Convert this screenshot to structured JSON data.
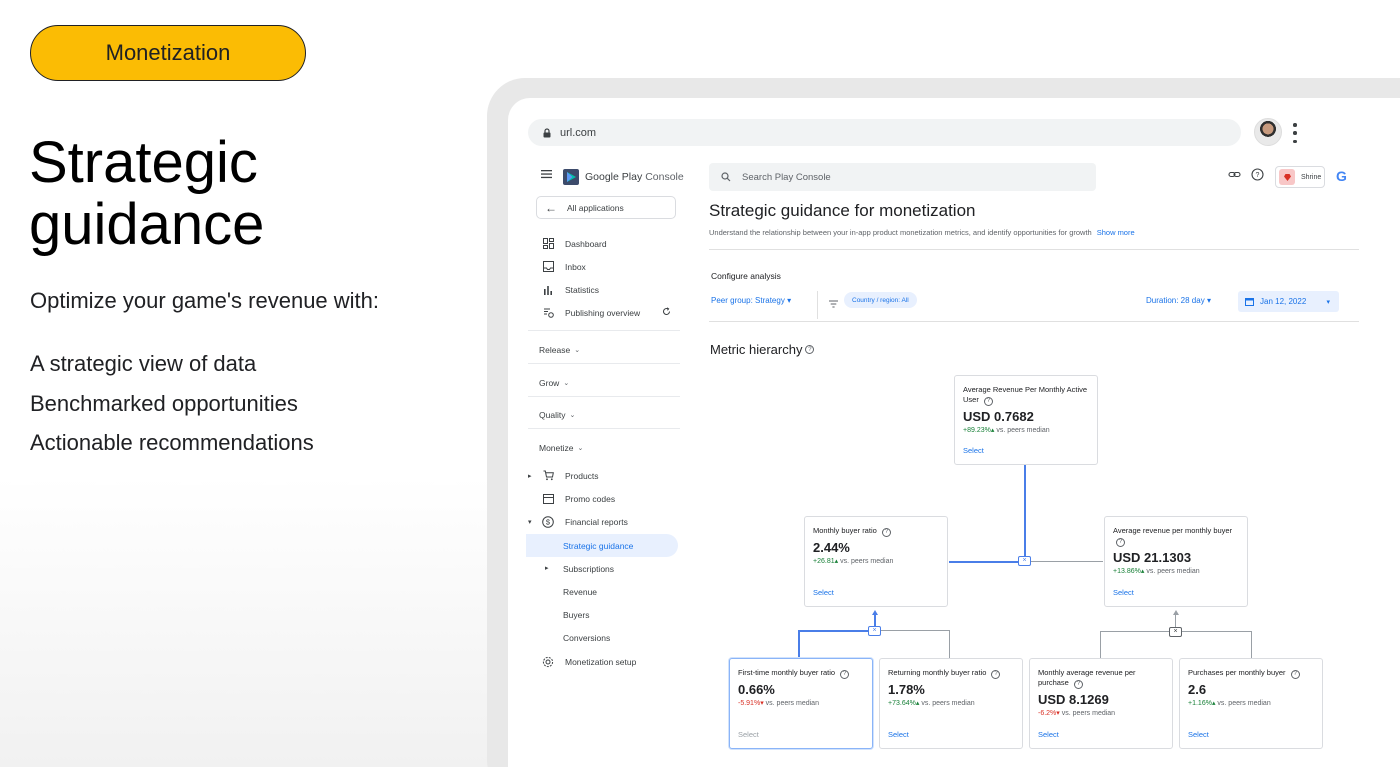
{
  "slide": {
    "tag": "Monetization",
    "title_line1": "Strategic",
    "title_line2": "guidance",
    "subtitle": "Optimize your game's revenue with:",
    "bullets": [
      "A strategic view of data",
      "Benchmarked opportunities",
      "Actionable recommendations"
    ]
  },
  "browser": {
    "url": "url.com"
  },
  "console": {
    "brand": "Google Play",
    "brand_suffix": "Console",
    "all_apps": "All applications",
    "search_placeholder": "Search Play Console",
    "app_name": "Shrine",
    "nav": {
      "dashboard": "Dashboard",
      "inbox": "Inbox",
      "statistics": "Statistics",
      "publishing": "Publishing overview",
      "release": "Release",
      "grow": "Grow",
      "quality": "Quality",
      "monetize": "Monetize",
      "products": "Products",
      "promo": "Promo codes",
      "financial": "Financial reports",
      "strategic": "Strategic guidance",
      "subscriptions": "Subscriptions",
      "revenue": "Revenue",
      "buyers": "Buyers",
      "conversions": "Conversions",
      "setup": "Monetization setup"
    }
  },
  "page": {
    "title": "Strategic guidance for monetization",
    "description": "Understand the relationship between your in-app product monetization metrics, and identify opportunities for growth",
    "show_more": "Show more",
    "configure": "Configure analysis",
    "peer_group": "Peer group: Strategy",
    "country_chip": "Country / region: All",
    "duration": "Duration: 28 day",
    "date": "Jan 12, 2022",
    "metric_hierarchy": "Metric hierarchy"
  },
  "metrics": {
    "arpmau": {
      "name": "Average Revenue Per Monthly Active User",
      "value": "USD 0.7682",
      "delta": "+89.23%",
      "suffix": "vs. peers median",
      "select": "Select"
    },
    "mbr": {
      "name": "Monthly buyer ratio",
      "value": "2.44%",
      "delta": "+26.81",
      "suffix": "vs. peers median",
      "select": "Select"
    },
    "arpmb": {
      "name": "Average revenue per monthly buyer",
      "value": "USD 21.1303",
      "delta": "+13.86%",
      "suffix": "vs. peers median",
      "select": "Select"
    },
    "ftmbr": {
      "name": "First-time monthly buyer ratio",
      "value": "0.66%",
      "delta": "-5.91%",
      "suffix": "vs. peers median",
      "select": "Select"
    },
    "rmbr": {
      "name": "Returning monthly buyer ratio",
      "value": "1.78%",
      "delta": "+73.64%",
      "suffix": "vs. peers median",
      "select": "Select"
    },
    "marpp": {
      "name": "Monthly average revenue per purchase",
      "value": "USD 8.1269",
      "delta": "-6.2%",
      "suffix": "vs. peers median",
      "select": "Select"
    },
    "ppmb": {
      "name": "Purchases per monthly buyer",
      "value": "2.6",
      "delta": "+1.16%",
      "suffix": "vs. peers median",
      "select": "Select"
    }
  },
  "colors": {
    "accent": "#1a73e8",
    "pill": "#fbbc04",
    "positive": "#188038",
    "negative": "#d93025"
  }
}
